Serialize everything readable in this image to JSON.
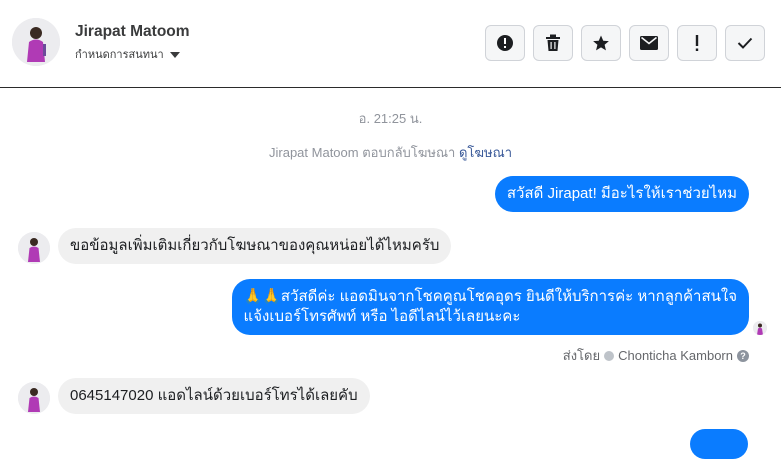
{
  "header": {
    "contact_name": "Jirapat Matoom",
    "assign_label": "กำหนดการสนทนา",
    "actions": [
      {
        "name": "spam",
        "icon": "alert-circle-icon"
      },
      {
        "name": "delete",
        "icon": "trash-icon"
      },
      {
        "name": "star",
        "icon": "star-icon"
      },
      {
        "name": "mark-unread",
        "icon": "envelope-icon"
      },
      {
        "name": "follow-up",
        "icon": "exclamation-icon"
      },
      {
        "name": "done",
        "icon": "check-icon"
      }
    ]
  },
  "thread": {
    "timestamp": "อ. 21:25 น.",
    "system_prefix": "Jirapat Matoom ตอบกลับโฆษณา",
    "system_link": "ดูโฆษณา",
    "messages": [
      {
        "dir": "out",
        "text": "สวัสดี Jirapat! มีอะไรให้เราช่วยไหม"
      },
      {
        "dir": "in",
        "text": "ขอข้อมูลเพิ่มเติมเกี่ยวกับโฆษณาของคุณหน่อยได้ไหมครับ"
      },
      {
        "dir": "out",
        "line1": "🙏🙏สวัสดีค่ะ แอดมินจากโชคคูณโชคอุดร ยินดีให้บริการค่ะ หากลูกค้าสนใจ",
        "line2": "แจ้งเบอร์โทรศัพท์ หรือ ไอดีไลน์ไว้เลยนะคะ"
      },
      {
        "dir": "in",
        "text": "0645147020  แอดไลน์ด้วยเบอร์โทรได้เลยคับ"
      }
    ],
    "sent_by_label": "ส่งโดย",
    "sent_by_name": "Chonticha Kamborn"
  },
  "colors": {
    "outgoing_bubble": "#0a7cff",
    "incoming_bubble": "#f0f0f0",
    "meta_text": "#90949c",
    "link": "#385898"
  }
}
